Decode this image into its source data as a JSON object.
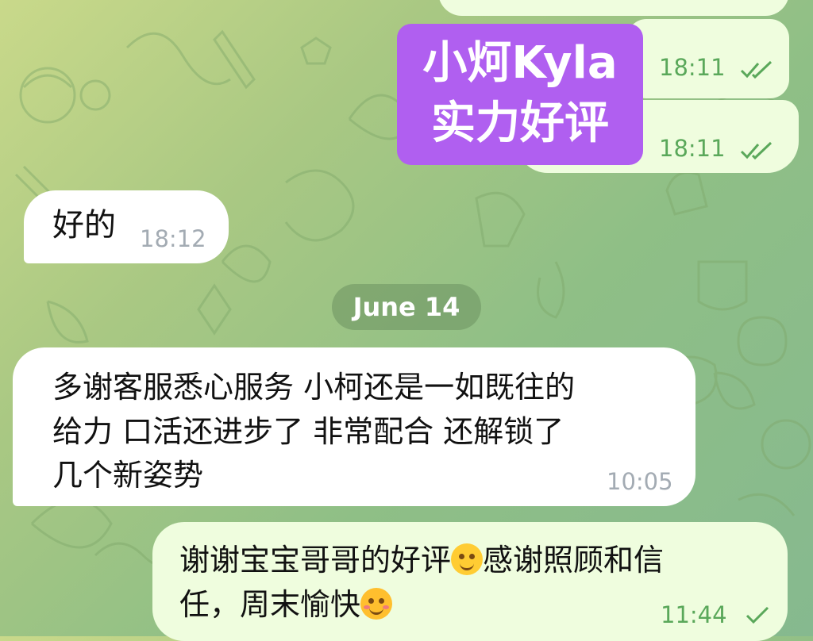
{
  "theme": {
    "incoming_bg": "#ffffff",
    "outgoing_bg": "#effdde",
    "sticker_bg": "#b05ff0",
    "time_color_in": "#a3abb3",
    "time_color_out": "#5aa85a"
  },
  "messages": [
    {
      "id": "sticker",
      "direction": "outgoing",
      "lines": [
        "小炣Kyla",
        "实力好评"
      ],
      "times": [
        "18:11",
        "18:11"
      ],
      "status": "read"
    },
    {
      "id": "reply1",
      "direction": "incoming",
      "text": "好的",
      "time": "18:12"
    },
    {
      "id": "review",
      "direction": "incoming",
      "lines": [
        "多谢客服悉心服务 小柯还是一如既往的",
        "给力 口活还进步了 非常配合 还解锁了",
        "几个新姿势"
      ],
      "time": "10:05"
    },
    {
      "id": "thanks",
      "direction": "outgoing",
      "line1_a": "谢谢宝宝哥哥的好评",
      "emoji1": "smiling-face-emoji",
      "line1_b": "感谢照顾和信",
      "line2": "任，周末愉快",
      "emoji2": "smiling-face-with-hearts-emoji",
      "time": "11:44",
      "status": "sent"
    }
  ],
  "date_separator": "June 14"
}
